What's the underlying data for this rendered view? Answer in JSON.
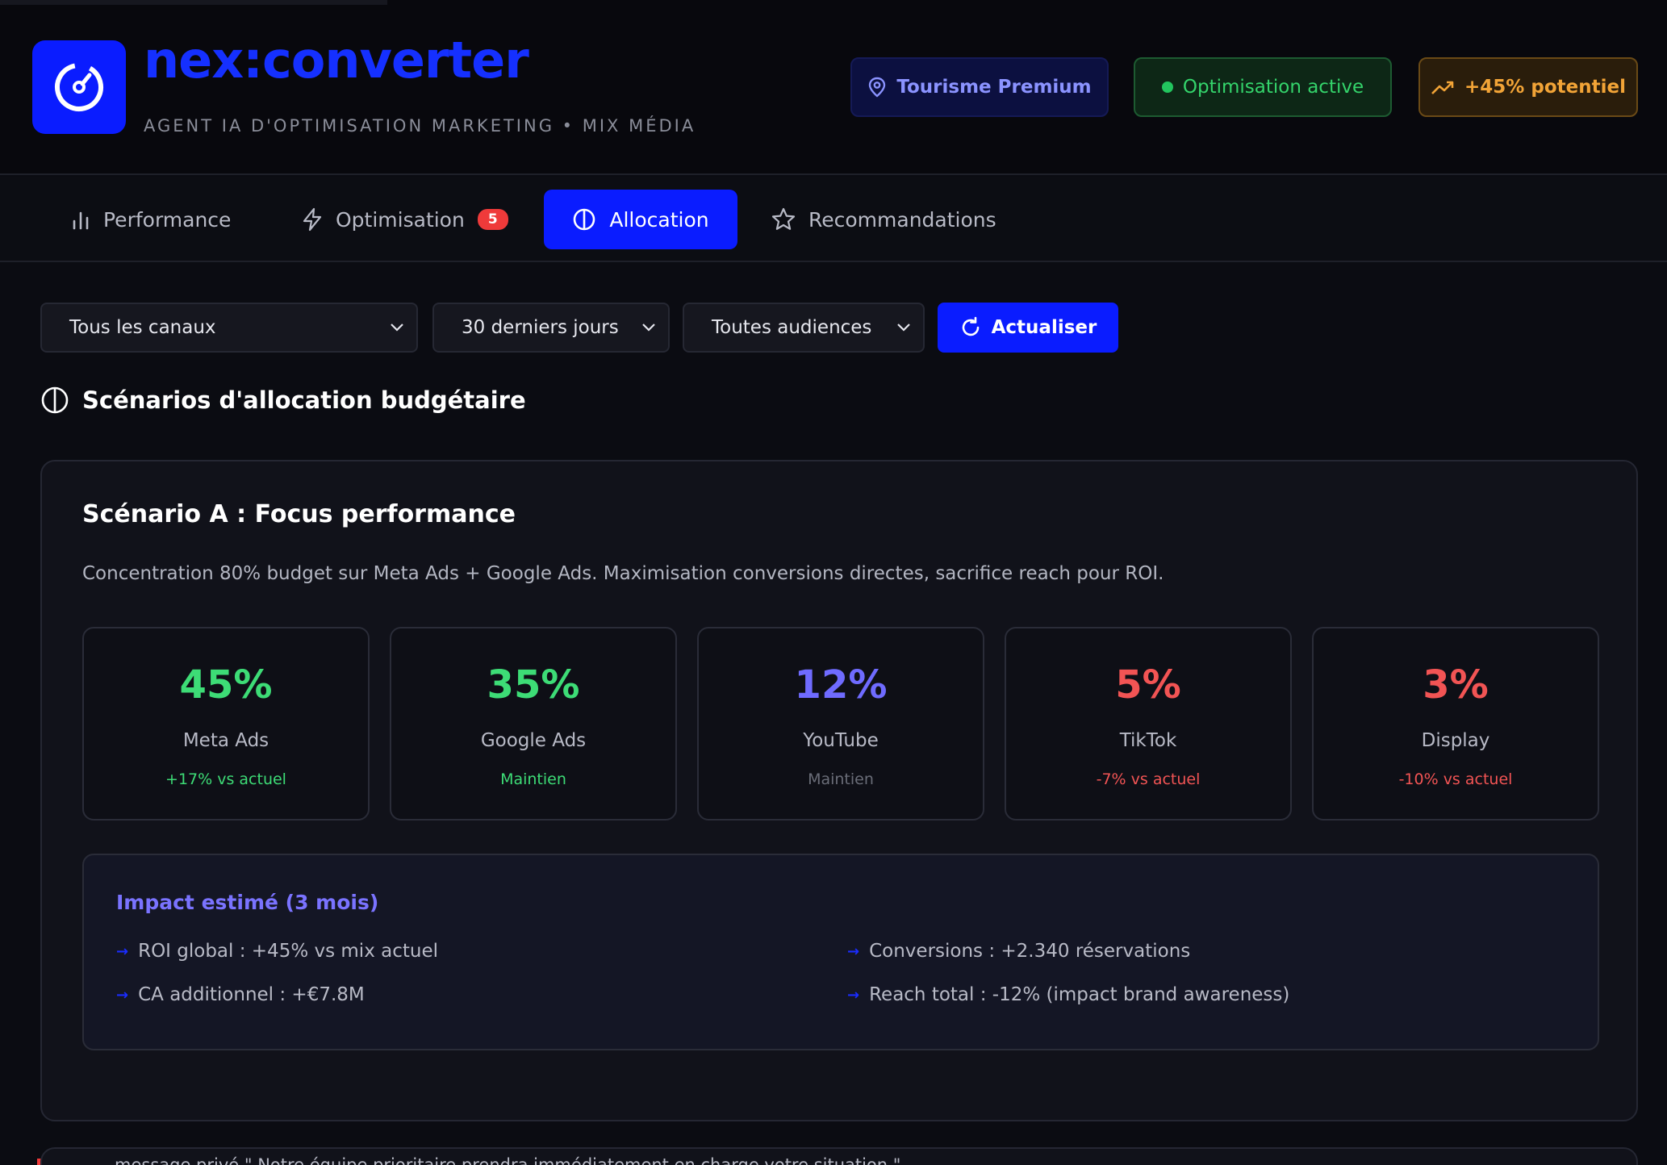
{
  "header": {
    "brand": "nex:converter",
    "tagline": "AGENT IA D'OPTIMISATION MARKETING • MIX MÉDIA",
    "badges": {
      "tourisme": "Tourisme Premium",
      "optimisation": "Optimisation active",
      "potentiel": "+45% potentiel"
    }
  },
  "tabs": [
    {
      "label": "Performance",
      "icon": "bar-chart-icon"
    },
    {
      "label": "Optimisation",
      "icon": "lightning-icon",
      "count": "5"
    },
    {
      "label": "Allocation",
      "icon": "half-circle-icon",
      "active": true
    },
    {
      "label": "Recommandations",
      "icon": "star-icon"
    }
  ],
  "filters": {
    "canaux": "Tous les canaux",
    "periode": "30 derniers jours",
    "audiences": "Toutes audiences",
    "refresh": "Actualiser"
  },
  "section": {
    "title": "Scénarios d'allocation budgétaire"
  },
  "scenario": {
    "title": "Scénario A : Focus performance",
    "description": "Concentration 80% budget sur Meta Ads + Google Ads. Maximisation conversions directes, sacrifice reach pour ROI.",
    "channels": [
      {
        "pct": "45%",
        "name": "Meta Ads",
        "delta": "+17% vs actuel",
        "pct_color": "#3ddc76",
        "delta_color": "#3ddc76"
      },
      {
        "pct": "35%",
        "name": "Google Ads",
        "delta": "Maintien",
        "pct_color": "#3ddc76",
        "delta_color": "#3ddc76"
      },
      {
        "pct": "12%",
        "name": "YouTube",
        "delta": "Maintien",
        "pct_color": "#6f6bff",
        "delta_color": "#6a6d78"
      },
      {
        "pct": "5%",
        "name": "TikTok",
        "delta": "-7% vs actuel",
        "pct_color": "#f25454",
        "delta_color": "#f25454"
      },
      {
        "pct": "3%",
        "name": "Display",
        "delta": "-10% vs actuel",
        "pct_color": "#f25454",
        "delta_color": "#f25454"
      }
    ],
    "impact": {
      "title": "Impact estimé (3 mois)",
      "items": [
        "ROI global : +45% vs mix actuel",
        "CA additionnel : +€7.8M",
        "Conversions : +2.340 réservations",
        "Reach total : -12% (impact brand awareness)"
      ]
    }
  },
  "bottom": {
    "text": "message privé.\" Notre équipe prioritaire prendra immédiatement en charge votre situation.\""
  },
  "colors": {
    "accent": "#0a1cff",
    "background": "#0b0c12",
    "success": "#22c55e",
    "warning": "#f2a437",
    "danger": "#ef3a3a"
  }
}
